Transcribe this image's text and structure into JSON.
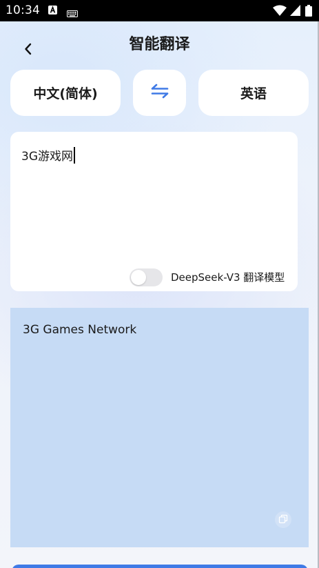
{
  "status_bar": {
    "time": "10:34",
    "icons": [
      "a-badge-icon",
      "keyboard-icon",
      "wifi-icon",
      "signal-icon",
      "battery-icon"
    ]
  },
  "header": {
    "title": "智能翻译",
    "back_icon": "chevron-left-icon"
  },
  "languages": {
    "source": "中文(简体)",
    "target": "英语",
    "swap_icon": "swap-arrows-icon"
  },
  "input": {
    "value": "3G游戏网",
    "model_toggle_on": false,
    "model_label": "DeepSeek-V3 翻译模型"
  },
  "output": {
    "value": "3G Games Network",
    "copy_icon": "copy-icon"
  },
  "colors": {
    "accent": "#3f7ae6",
    "output_background": "#c6dbf5",
    "card_background": "#ffffff"
  }
}
